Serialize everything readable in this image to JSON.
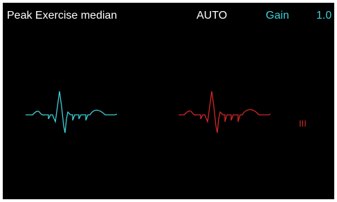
{
  "header": {
    "title": "Peak Exercise median",
    "mode": "AUTO",
    "gain_label": "Gain",
    "gain_value": "1.0"
  },
  "traces": {
    "left": {
      "color": "#3fd0d8",
      "icon": "ecg-median-complex"
    },
    "right": {
      "color": "#d42626",
      "icon": "ecg-median-complex",
      "lead_label": "III"
    }
  },
  "colors": {
    "background": "#000000",
    "text": "#ffffff",
    "accent_cyan": "#3fd0d8",
    "accent_red": "#d42626"
  }
}
